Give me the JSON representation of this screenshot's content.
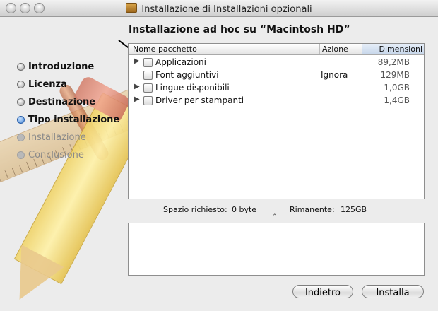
{
  "window": {
    "title": "Installazione di Installazioni opzionali"
  },
  "sidebar": {
    "steps": [
      {
        "label": "Introduzione",
        "state": "done"
      },
      {
        "label": "Licenza",
        "state": "done"
      },
      {
        "label": "Destinazione",
        "state": "done"
      },
      {
        "label": "Tipo installazione",
        "state": "current"
      },
      {
        "label": "Installazione",
        "state": "todo"
      },
      {
        "label": "Conclusione",
        "state": "todo"
      }
    ]
  },
  "main": {
    "heading": "Installazione ad hoc su “Macintosh HD”",
    "columns": {
      "name": "Nome pacchetto",
      "action": "Azione",
      "size": "Dimensioni"
    },
    "packages": [
      {
        "disclosure": true,
        "name": "Applicazioni",
        "action": "",
        "size": "89,2MB",
        "checked": false
      },
      {
        "disclosure": false,
        "name": "Font aggiuntivi",
        "action": "Ignora",
        "size": "129MB",
        "checked": false
      },
      {
        "disclosure": true,
        "name": "Lingue disponibili",
        "action": "",
        "size": "1,0GB",
        "checked": false
      },
      {
        "disclosure": true,
        "name": "Driver per stampanti",
        "action": "",
        "size": "1,4GB",
        "checked": false
      }
    ],
    "space": {
      "required_label": "Spazio richiesto:",
      "required_value": "0 byte",
      "remaining_label": "Rimanente:",
      "remaining_value": "125GB"
    },
    "description": ""
  },
  "buttons": {
    "back": "Indietro",
    "install": "Installa"
  },
  "colors": {
    "window_bg": "#ececec",
    "current_step_bullet": "#3b7fd4",
    "sorted_column": "#c6d6ea"
  }
}
